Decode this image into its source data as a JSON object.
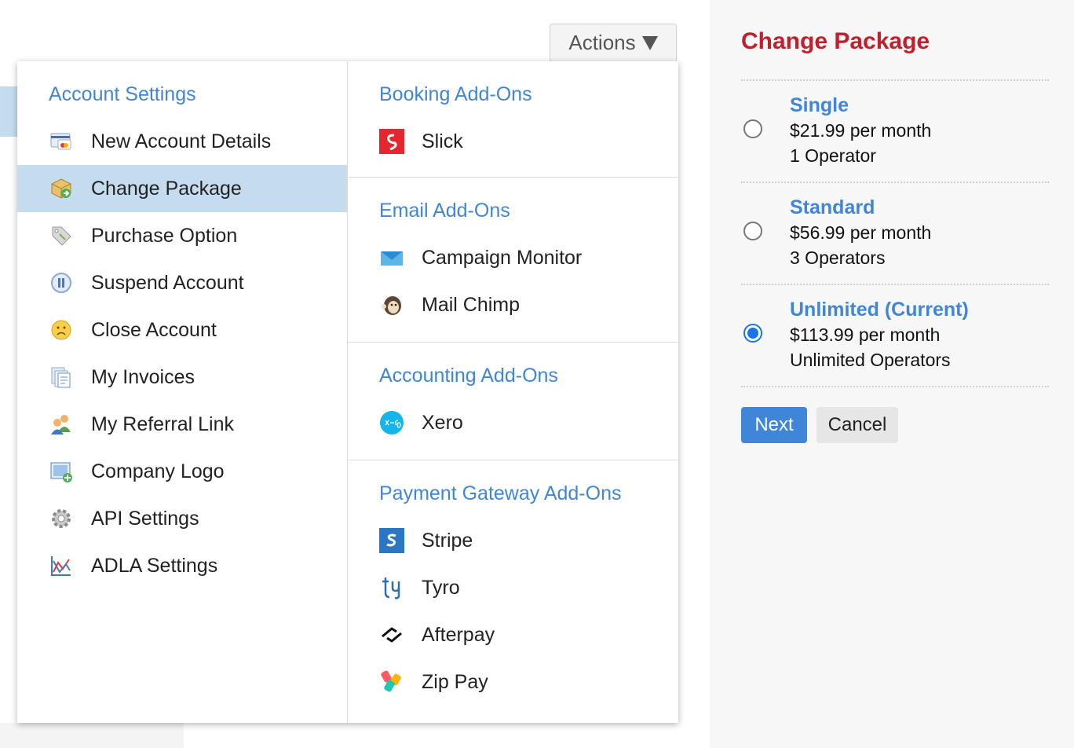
{
  "actions": {
    "label": "Actions"
  },
  "account_settings": {
    "heading": "Account Settings",
    "items": [
      {
        "label": "New Account Details",
        "icon": "credit-card-icon"
      },
      {
        "label": "Change Package",
        "icon": "package-icon",
        "active": true
      },
      {
        "label": "Purchase Option",
        "icon": "tag-icon"
      },
      {
        "label": "Suspend Account",
        "icon": "pause-icon"
      },
      {
        "label": "Close Account",
        "icon": "sad-face-icon"
      },
      {
        "label": "My Invoices",
        "icon": "invoices-icon"
      },
      {
        "label": "My Referral Link",
        "icon": "users-icon"
      },
      {
        "label": "Company Logo",
        "icon": "image-add-icon"
      },
      {
        "label": "API Settings",
        "icon": "gear-icon"
      },
      {
        "label": "ADLA Settings",
        "icon": "chart-icon"
      }
    ]
  },
  "booking_addons": {
    "heading": "Booking Add-Ons",
    "items": [
      {
        "label": "Slick",
        "icon": "slick-logo-icon"
      }
    ]
  },
  "email_addons": {
    "heading": "Email Add-Ons",
    "items": [
      {
        "label": "Campaign Monitor",
        "icon": "campaign-monitor-icon"
      },
      {
        "label": "Mail Chimp",
        "icon": "mailchimp-icon"
      }
    ]
  },
  "accounting_addons": {
    "heading": "Accounting Add-Ons",
    "items": [
      {
        "label": "Xero",
        "icon": "xero-icon"
      }
    ]
  },
  "payment_addons": {
    "heading": "Payment Gateway Add-Ons",
    "items": [
      {
        "label": "Stripe",
        "icon": "stripe-icon"
      },
      {
        "label": "Tyro",
        "icon": "tyro-icon"
      },
      {
        "label": "Afterpay",
        "icon": "afterpay-icon"
      },
      {
        "label": "Zip Pay",
        "icon": "zippay-icon"
      }
    ]
  },
  "change_package": {
    "title": "Change Package",
    "plans": [
      {
        "name": "Single",
        "price": "$21.99 per month",
        "operators": "1 Operator",
        "selected": false
      },
      {
        "name": "Standard",
        "price": "$56.99 per month",
        "operators": "3 Operators",
        "selected": false
      },
      {
        "name": "Unlimited (Current)",
        "price": "$113.99 per month",
        "operators": "Unlimited Operators",
        "selected": true
      }
    ],
    "next_label": "Next",
    "cancel_label": "Cancel"
  },
  "colors": {
    "accent": "#3f86d8",
    "title_red": "#c0202e",
    "active_row": "#c5dcee",
    "radio_checked": "#1a73e8"
  }
}
